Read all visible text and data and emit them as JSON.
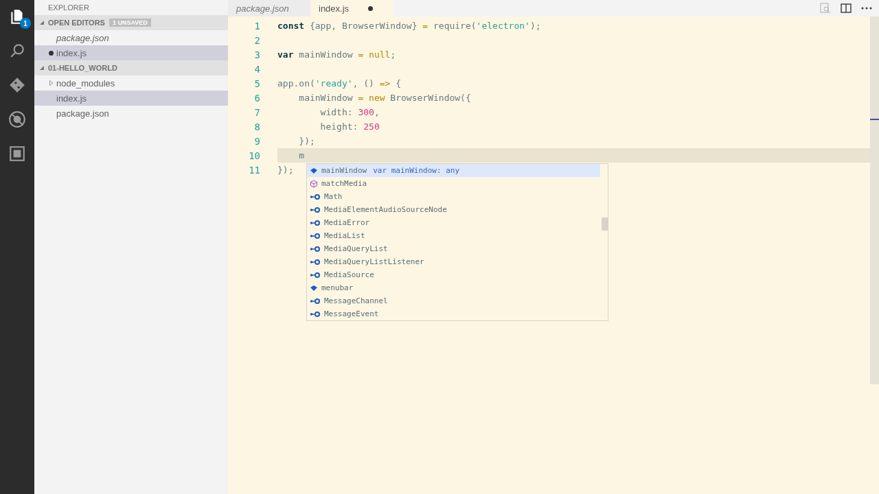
{
  "activity_bar": {
    "items": [
      {
        "kind": "files",
        "selected": true,
        "badge": "1"
      },
      {
        "kind": "search",
        "selected": false
      },
      {
        "kind": "git",
        "selected": false
      },
      {
        "kind": "debug",
        "selected": false
      },
      {
        "kind": "extensions",
        "selected": false
      }
    ]
  },
  "sidebar": {
    "title": "EXPLORER",
    "sections": [
      {
        "title": "OPEN EDITORS",
        "badge": "1 UNSAVED",
        "expanded": true,
        "items": [
          {
            "label": "package.json",
            "italic": true,
            "dirty": false,
            "selected": false
          },
          {
            "label": "index.js",
            "italic": false,
            "dirty": true,
            "selected": true
          }
        ]
      },
      {
        "title": "01-HELLO_WORLD",
        "expanded": true,
        "items": [
          {
            "label": "node_modules",
            "kind": "folder",
            "expanded": false,
            "selected": false
          },
          {
            "label": "index.js",
            "kind": "file",
            "selected": true
          },
          {
            "label": "package.json",
            "kind": "file",
            "selected": false
          }
        ]
      }
    ]
  },
  "tabs": [
    {
      "label": "package.json",
      "italic": true,
      "dirty": false,
      "selected": false
    },
    {
      "label": "index.js",
      "italic": false,
      "dirty": true,
      "selected": true
    }
  ],
  "editor": {
    "lines": [
      {
        "number": "1",
        "current": false,
        "tokens": [
          {
            "text": "const",
            "kind": "keyword"
          },
          {
            "text": " {app, BrowserWindow} ",
            "kind": "plain"
          },
          {
            "text": "=",
            "kind": "operator"
          },
          {
            "text": " require(",
            "kind": "plain"
          },
          {
            "text": "'electron'",
            "kind": "string"
          },
          {
            "text": ");",
            "kind": "plain"
          }
        ]
      },
      {
        "number": "2",
        "current": false
      },
      {
        "number": "3",
        "current": false,
        "tokens": [
          {
            "text": "var",
            "kind": "keyword"
          },
          {
            "text": " mainWindow ",
            "kind": "plain"
          },
          {
            "text": "= null",
            "kind": "operator"
          },
          {
            "text": ";",
            "kind": "plain"
          }
        ]
      },
      {
        "number": "4",
        "current": false
      },
      {
        "number": "5",
        "current": false,
        "tokens": [
          {
            "text": "app.on(",
            "kind": "plain"
          },
          {
            "text": "'ready'",
            "kind": "string"
          },
          {
            "text": ", () ",
            "kind": "plain"
          },
          {
            "text": "=>",
            "kind": "operator"
          },
          {
            "text": " {",
            "kind": "plain"
          }
        ]
      },
      {
        "number": "6",
        "current": false,
        "tokens": [
          {
            "text": "    mainWindow ",
            "kind": "plain"
          },
          {
            "text": "= new",
            "kind": "operator"
          },
          {
            "text": " BrowserWindow({",
            "kind": "plain"
          }
        ]
      },
      {
        "number": "7",
        "current": false,
        "tokens": [
          {
            "text": "        width: ",
            "kind": "plain"
          },
          {
            "text": "300",
            "kind": "number"
          },
          {
            "text": ",",
            "kind": "plain"
          }
        ]
      },
      {
        "number": "8",
        "current": false,
        "tokens": [
          {
            "text": "        height: ",
            "kind": "plain"
          },
          {
            "text": "250",
            "kind": "number"
          }
        ]
      },
      {
        "number": "9",
        "current": false,
        "tokens": [
          {
            "text": "    });",
            "kind": "plain"
          }
        ]
      },
      {
        "number": "10",
        "current": true,
        "tokens": [
          {
            "text": "    m",
            "kind": "plain"
          }
        ]
      },
      {
        "number": "11",
        "current": false,
        "tokens": [
          {
            "text": "});",
            "kind": "plain"
          }
        ]
      }
    ],
    "suggestions": [
      {
        "label": "mainWindow",
        "kind": "variable",
        "detail": "var mainWindow: any",
        "selected": true
      },
      {
        "label": "matchMedia",
        "kind": "method",
        "selected": false
      },
      {
        "label": "Math",
        "kind": "class",
        "selected": false
      },
      {
        "label": "MediaElementAudioSourceNode",
        "kind": "class",
        "selected": false
      },
      {
        "label": "MediaError",
        "kind": "class",
        "selected": false
      },
      {
        "label": "MediaList",
        "kind": "class",
        "selected": false
      },
      {
        "label": "MediaQueryList",
        "kind": "class",
        "selected": false
      },
      {
        "label": "MediaQueryListListener",
        "kind": "class",
        "selected": false
      },
      {
        "label": "MediaSource",
        "kind": "class",
        "selected": false
      },
      {
        "label": "menubar",
        "kind": "variable",
        "selected": false
      },
      {
        "label": "MessageChannel",
        "kind": "class",
        "selected": false
      },
      {
        "label": "MessageEvent",
        "kind": "class",
        "selected": false
      }
    ]
  }
}
